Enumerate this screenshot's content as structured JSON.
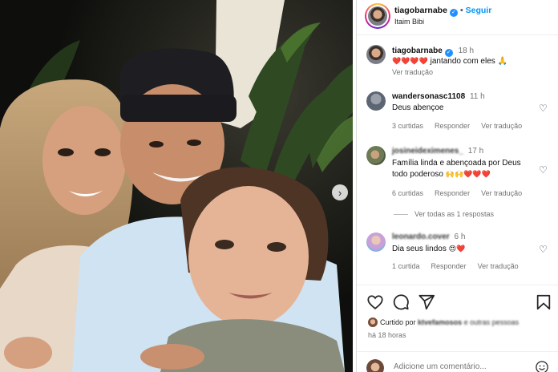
{
  "post_header": {
    "username": "tiagobarnabe",
    "follow_label": "Seguir",
    "location": "Itaim Bibi"
  },
  "caption": {
    "username": "tiagobarnabe",
    "time": "18 h",
    "hearts": "❤️❤️❤️❤️",
    "text": "jantando com eles",
    "emoji": "🙏",
    "see_translation": "Ver tradução"
  },
  "comments": [
    {
      "username": "wandersonasc1108",
      "time": "11 h",
      "text": "Deus abençoe",
      "likes": "3 curtidas",
      "reply": "Responder",
      "translate": "Ver tradução"
    },
    {
      "username": "josineideximenes_",
      "time": "17 h",
      "text_line1": "Família linda e abençoada por Deus",
      "text_line2": "todo poderoso",
      "emoji": "🙌🙌❤️❤️❤️",
      "likes": "6 curtidas",
      "reply": "Responder",
      "translate": "Ver tradução",
      "view_replies": "Ver todas as 1 respostas"
    },
    {
      "username": "leonardo.cover",
      "time": "6 h",
      "text": "Dia seus lindos",
      "emoji": "😍❤️",
      "likes": "1 curtida",
      "reply": "Responder",
      "translate": "Ver tradução"
    }
  ],
  "liked_by": {
    "prefix": "Curtido por",
    "user": "ktvefamosos",
    "suffix": "e outras pessoas"
  },
  "post_time": "há 18 horas",
  "add_comment_placeholder": "Adicione um comentário...",
  "icons": {
    "verified": "verified-badge-icon",
    "next": "chevron-right-icon",
    "heart": "heart-icon",
    "comment": "comment-icon",
    "share": "share-icon",
    "save": "bookmark-icon",
    "emoji": "smiley-icon"
  },
  "colors": {
    "accent": "#0095f6",
    "verified": "#1e90ff",
    "muted": "#737373"
  }
}
